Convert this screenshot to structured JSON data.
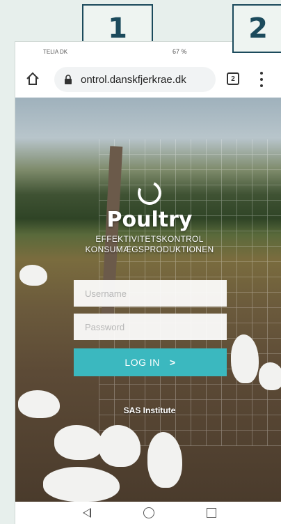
{
  "callouts": {
    "one": "1",
    "two": "2"
  },
  "status_bar": {
    "carrier": "TELIA DK",
    "right": "67 %"
  },
  "browser": {
    "url": "ontrol.danskfjerkrae.dk",
    "tab_count": "2"
  },
  "login_page": {
    "brand": "Poultry",
    "subtitle_line1": "EFFEKTIVITETSKONTROL",
    "subtitle_line2": "KONSUMÆGSPRODUKTIONEN",
    "username_placeholder": "Username",
    "password_placeholder": "Password",
    "login_label": "LOG IN",
    "login_chevron": ">",
    "footer": "SAS Institute"
  },
  "colors": {
    "accent": "#3bb8bf",
    "callout_border": "#1b4a5c"
  }
}
